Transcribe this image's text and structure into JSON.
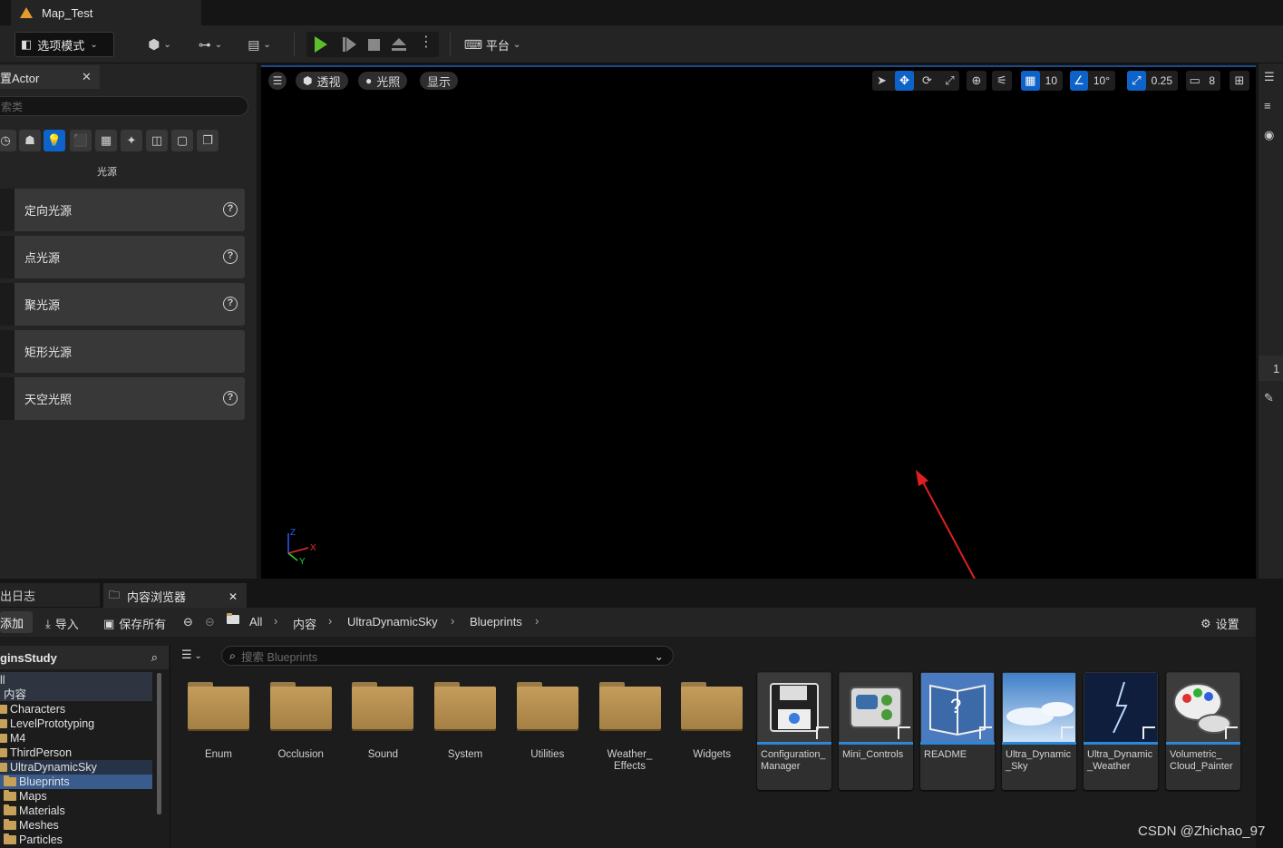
{
  "window": {
    "doc_tab": "Map_Test"
  },
  "toolbar": {
    "mode_label": "选项模式",
    "platform_label": "平台"
  },
  "place_actors": {
    "tab_title": "置Actor",
    "search_placeholder": "索类",
    "category_label": "光源",
    "items": [
      {
        "label": "定向光源",
        "help": "?"
      },
      {
        "label": "点光源",
        "help": "?"
      },
      {
        "label": "聚光源",
        "help": "?"
      },
      {
        "label": "矩形光源",
        "help": ""
      },
      {
        "label": "天空光照",
        "help": "?"
      }
    ]
  },
  "viewport": {
    "perspective_label": "透视",
    "lighting_label": "光照",
    "show_label": "显示",
    "grid_snap": "10",
    "rotate_snap": "10°",
    "scale_snap": "0.25",
    "camera_speed": "8",
    "axis_labels": {
      "z": "Z",
      "x": "X",
      "y": "Y"
    }
  },
  "bottom_tabs": {
    "log_tab": "出日志",
    "content_browser_tab": "内容浏览器"
  },
  "content_browser": {
    "add_label": "添加",
    "import_label": "导入",
    "save_all_label": "保存所有",
    "settings_label": "设置",
    "breadcrumb": [
      "All",
      "内容",
      "UltraDynamicSky",
      "Blueprints"
    ],
    "search_placeholder": "搜索 Blueprints",
    "sources_header": "ginsStudy",
    "tree": [
      {
        "label": "ll",
        "indent": 0,
        "folder": false
      },
      {
        "label": "内容",
        "indent": 0,
        "folder": false
      },
      {
        "label": "Characters",
        "indent": 1,
        "folder": true
      },
      {
        "label": "LevelPrototyping",
        "indent": 1,
        "folder": true
      },
      {
        "label": "M4",
        "indent": 1,
        "folder": true
      },
      {
        "label": "ThirdPerson",
        "indent": 1,
        "folder": true
      },
      {
        "label": "UltraDynamicSky",
        "indent": 1,
        "folder": true
      },
      {
        "label": "Blueprints",
        "indent": 2,
        "folder": true
      },
      {
        "label": "Maps",
        "indent": 2,
        "folder": true
      },
      {
        "label": "Materials",
        "indent": 2,
        "folder": true
      },
      {
        "label": "Meshes",
        "indent": 2,
        "folder": true
      },
      {
        "label": "Particles",
        "indent": 2,
        "folder": true
      }
    ],
    "folders": [
      "Enum",
      "Occlusion",
      "Sound",
      "System",
      "Utilities",
      "Weather_\nEffects",
      "Widgets"
    ],
    "assets": [
      {
        "name": "Configuration_\nManager",
        "thumb": "floppy-gear-icon"
      },
      {
        "name": "Mini_Controls",
        "thumb": "controls-icon"
      },
      {
        "name": "README",
        "thumb": "book-question-icon"
      },
      {
        "name": "Ultra_Dynamic\n_Sky",
        "thumb": "sky-icon"
      },
      {
        "name": "Ultra_Dynamic\n_Weather",
        "thumb": "lightning-icon"
      },
      {
        "name": "Volumetric_\nCloud_Painter",
        "thumb": "palette-cloud-icon"
      }
    ]
  },
  "watermark": "CSDN @Zhichao_97",
  "colors": {
    "accent_blue": "#0e63c8",
    "play_green": "#5cbf2a",
    "annotation_red": "#e02020",
    "folder_tan": "#c49d5c"
  }
}
